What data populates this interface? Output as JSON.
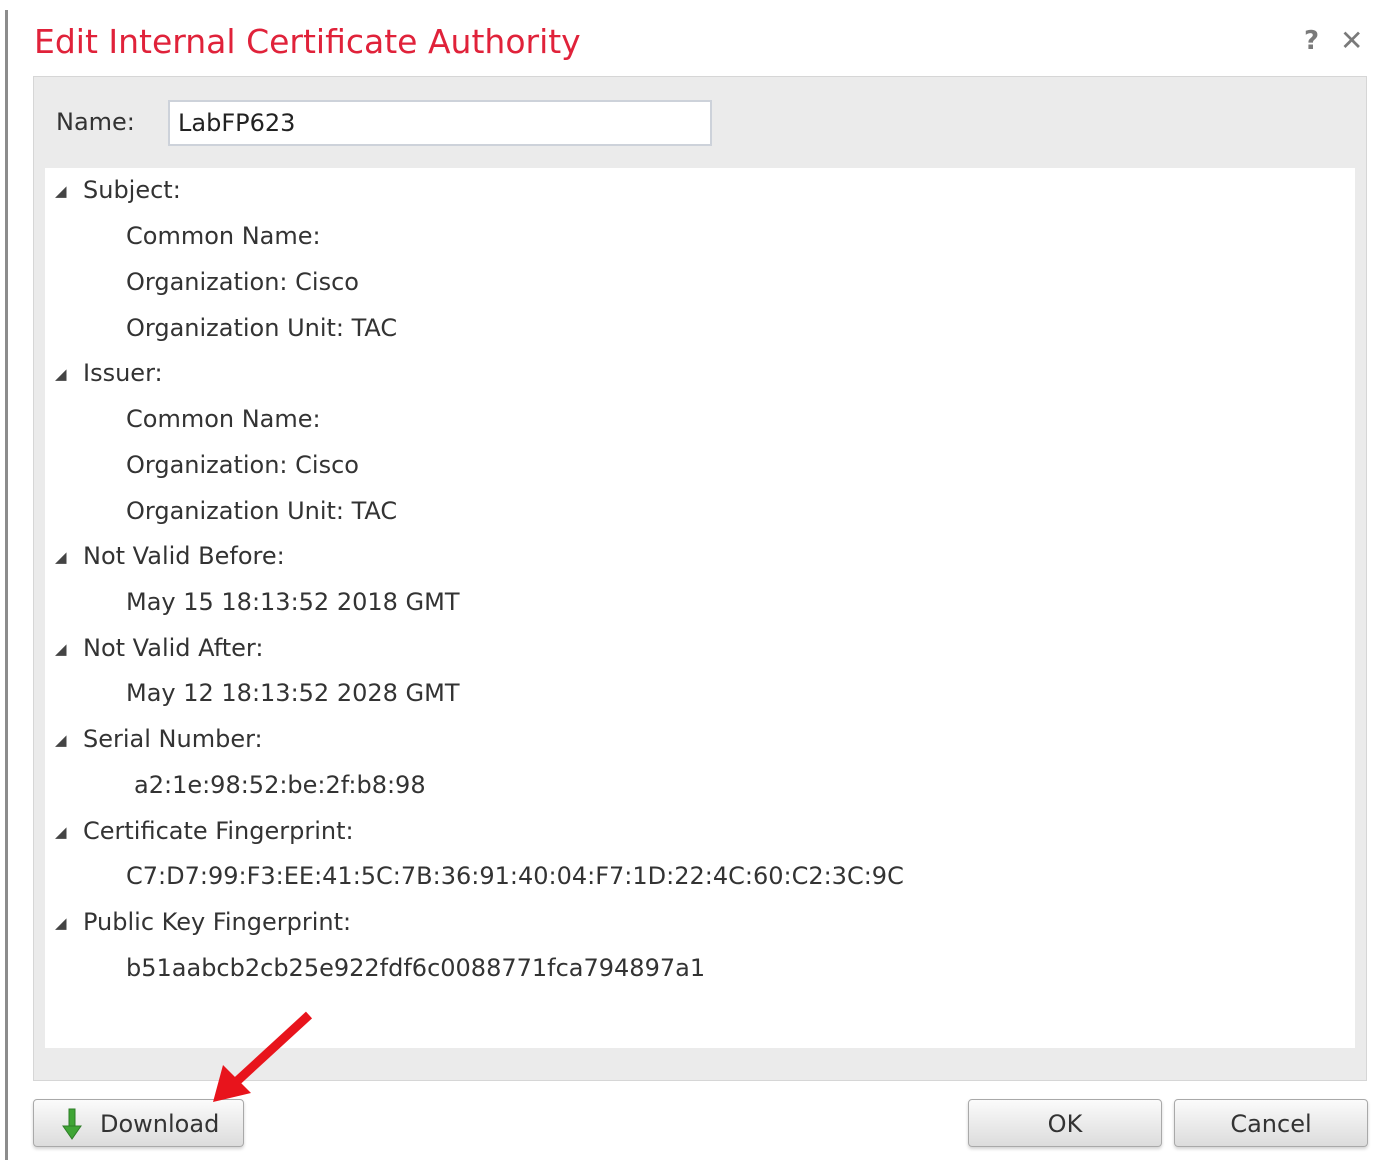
{
  "dialog": {
    "title": "Edit Internal Certificate Authority",
    "help_glyph": "?",
    "close_glyph": "✕"
  },
  "name_field": {
    "label": "Name:",
    "value": "LabFP623"
  },
  "sections": {
    "subject": {
      "heading": "Subject:",
      "common_name": "Common Name:",
      "organization": "Organization: Cisco",
      "organization_unit": "Organization Unit: TAC"
    },
    "issuer": {
      "heading": "Issuer:",
      "common_name": "Common Name:",
      "organization": "Organization: Cisco",
      "organization_unit": "Organization Unit: TAC"
    },
    "not_valid_before": {
      "heading": "Not Valid Before:",
      "value": "May 15 18:13:52 2018 GMT"
    },
    "not_valid_after": {
      "heading": "Not Valid After:",
      "value": "May 12 18:13:52 2028 GMT"
    },
    "serial_number": {
      "heading": "Serial Number:",
      "value": "a2:1e:98:52:be:2f:b8:98"
    },
    "certificate_fingerprint": {
      "heading": "Certificate Fingerprint:",
      "value": "C7:D7:99:F3:EE:41:5C:7B:36:91:40:04:F7:1D:22:4C:60:C2:3C:9C"
    },
    "public_key_fingerprint": {
      "heading": "Public Key Fingerprint:",
      "value": "b51aabcb2cb25e922fdf6c0088771fca794897a1"
    }
  },
  "buttons": {
    "download": "Download",
    "ok": "OK",
    "cancel": "Cancel"
  },
  "icons": {
    "tree_toggle": "◢",
    "download": "green-down-arrow-icon",
    "annotation": "red-arrow"
  },
  "colors": {
    "title": "#e0223a",
    "download_arrow": "#3fa535",
    "annotation_arrow": "#e8141c"
  }
}
